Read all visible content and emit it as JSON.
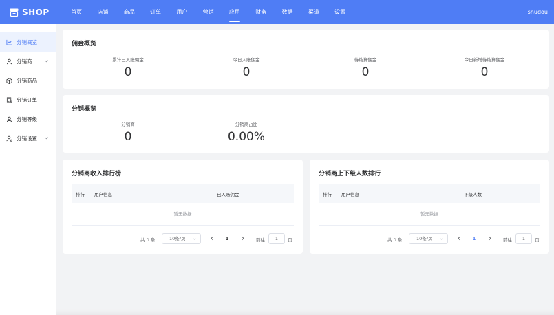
{
  "header": {
    "logo_text": "SHOP",
    "nav": [
      {
        "label": "首页",
        "active": false
      },
      {
        "label": "店铺",
        "active": false
      },
      {
        "label": "商品",
        "active": false
      },
      {
        "label": "订单",
        "active": false
      },
      {
        "label": "用户",
        "active": false
      },
      {
        "label": "营销",
        "active": false
      },
      {
        "label": "应用",
        "active": true
      },
      {
        "label": "财务",
        "active": false
      },
      {
        "label": "数据",
        "active": false
      },
      {
        "label": "渠道",
        "active": false
      },
      {
        "label": "设置",
        "active": false
      }
    ],
    "user": "shudou",
    "bg_color": "#4f7df5"
  },
  "sidebar": {
    "items": [
      {
        "label": "分销概览",
        "icon": "line-chart-icon",
        "active": true,
        "expandable": false
      },
      {
        "label": "分销商",
        "icon": "user-icon",
        "active": false,
        "expandable": true
      },
      {
        "label": "分销商品",
        "icon": "box-icon",
        "active": false,
        "expandable": false
      },
      {
        "label": "分销订单",
        "icon": "receipt-icon",
        "active": false,
        "expandable": false
      },
      {
        "label": "分销等级",
        "icon": "user-icon",
        "active": false,
        "expandable": false
      },
      {
        "label": "分销设置",
        "icon": "user-gear-icon",
        "active": false,
        "expandable": true
      }
    ]
  },
  "commission": {
    "title": "佣金概览",
    "stats": [
      {
        "label": "累计已入账佣金",
        "value": "0"
      },
      {
        "label": "今日入账佣金",
        "value": "0"
      },
      {
        "label": "待结算佣金",
        "value": "0"
      },
      {
        "label": "今日新增待结算佣金",
        "value": "0"
      }
    ]
  },
  "distribution": {
    "title": "分销概览",
    "stats": [
      {
        "label": "分销商",
        "value": "0"
      },
      {
        "label": "分销商占比",
        "value": "0.00%"
      }
    ]
  },
  "income_rank": {
    "title": "分销商收入排行榜",
    "columns": [
      "排行",
      "用户信息",
      "已入账佣金"
    ],
    "empty_text": "暂无数据",
    "pager": {
      "total": "共 0 条",
      "size": "10条/页",
      "page": "1",
      "goto": "前往",
      "goto_value": "1",
      "page_unit": "页"
    }
  },
  "people_rank": {
    "title": "分销商上下级人数排行",
    "columns": [
      "排行",
      "用户信息",
      "下级人数"
    ],
    "empty_text": "暂无数据",
    "pager": {
      "total": "共 0 条",
      "size": "10条/页",
      "page": "1",
      "goto": "前往",
      "goto_value": "1",
      "page_unit": "页"
    }
  }
}
